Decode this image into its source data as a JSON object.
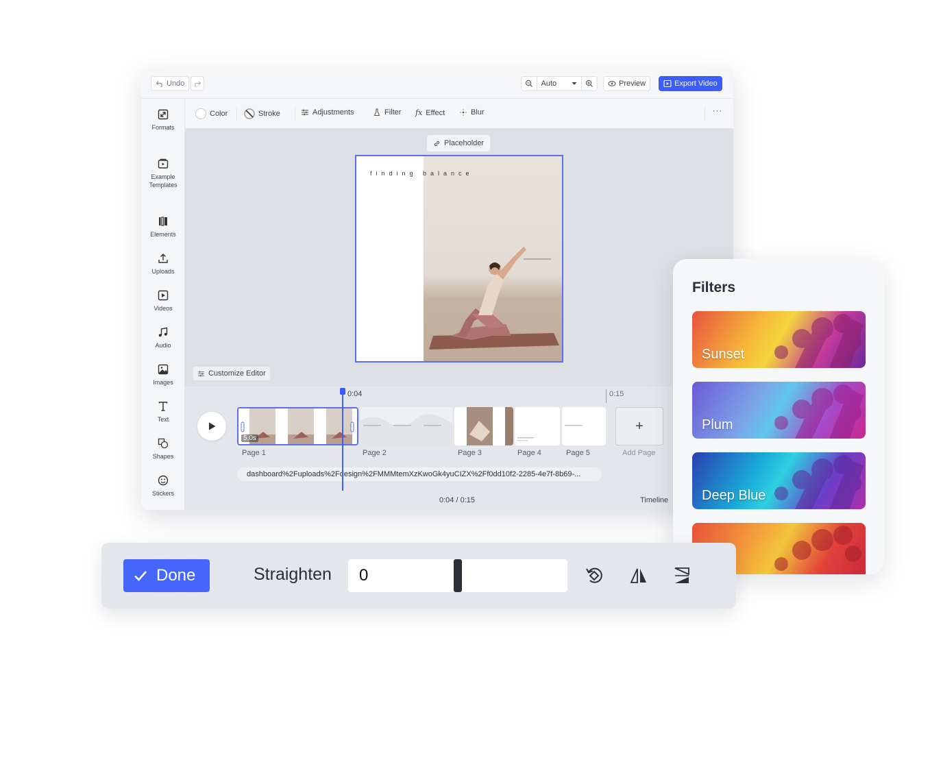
{
  "topbar": {
    "undo_label": "Undo",
    "zoom_value": "Auto",
    "preview_label": "Preview",
    "export_label": "Export Video"
  },
  "sidebar": {
    "items": [
      {
        "label": "Formats",
        "icon": "resize-icon"
      },
      {
        "label": "Example Templates",
        "icon": "template-icon"
      },
      {
        "label": "Elements",
        "icon": "elements-icon"
      },
      {
        "label": "Uploads",
        "icon": "upload-icon"
      },
      {
        "label": "Videos",
        "icon": "video-icon"
      },
      {
        "label": "Audio",
        "icon": "music-icon"
      },
      {
        "label": "Images",
        "icon": "image-icon"
      },
      {
        "label": "Text",
        "icon": "text-icon"
      },
      {
        "label": "Shapes",
        "icon": "shapes-icon"
      },
      {
        "label": "Stickers",
        "icon": "sticker-icon"
      }
    ]
  },
  "toolbar": {
    "color_label": "Color",
    "stroke_label": "Stroke",
    "adjustments_label": "Adjustments",
    "filter_label": "Filter",
    "effect_label": "Effect",
    "blur_label": "Blur",
    "more_label": "···"
  },
  "canvas": {
    "placeholder_label": "Placeholder",
    "page_title": "finding balance",
    "customize_label": "Customize Editor"
  },
  "timeline": {
    "current_marker": "0:04",
    "end_marker": "0:15",
    "clip_duration": "5.0s",
    "pages": [
      "Page 1",
      "Page 2",
      "Page 3",
      "Page 4",
      "Page 5"
    ],
    "add_page_symbol": "+",
    "add_page_label": "Add Page",
    "audio_file": "dashboard%2Fuploads%2Fdesign%2FMMMtemXzKwoGk4yuCIZX%2Ff0dd10f2-2285-4e7f-8b69-...",
    "time_readout": "0:04 / 0:15",
    "timeline_label": "Timeline"
  },
  "filters": {
    "title": "Filters",
    "items": [
      {
        "name": "Sunset"
      },
      {
        "name": "Plum"
      },
      {
        "name": "Deep Blue"
      },
      {
        "name": ""
      }
    ]
  },
  "straighten": {
    "done_label": "Done",
    "label": "Straighten",
    "value": "0"
  },
  "colors": {
    "accent": "#3d5dfb",
    "done_button": "#4466fa",
    "selection_border": "#5b6ef5"
  }
}
